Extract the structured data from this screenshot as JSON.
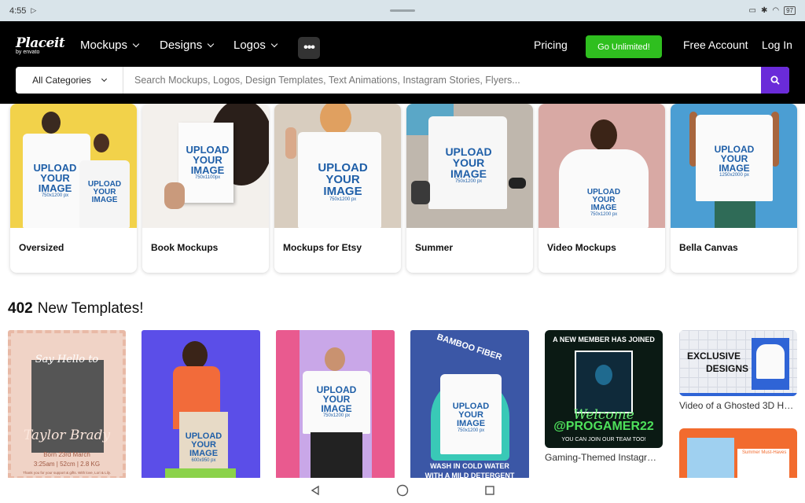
{
  "status": {
    "time": "4:55",
    "battery": "97"
  },
  "nav": {
    "logo_main": "Placeit",
    "logo_sub": "by envato",
    "menus": [
      "Mockups",
      "Designs",
      "Logos"
    ],
    "more": "•••",
    "pricing": "Pricing",
    "go_unlimited": "Go Unlimited!",
    "free_account": "Free Account",
    "login": "Log In"
  },
  "search": {
    "category": "All Categories",
    "placeholder": "Search Mockups, Logos, Design Templates, Text Animations, Instagram Stories, Flyers..."
  },
  "categories": [
    {
      "label": "Oversized"
    },
    {
      "label": "Book Mockups"
    },
    {
      "label": "Mockups for Etsy"
    },
    {
      "label": "Summer"
    },
    {
      "label": "Video Mockups"
    },
    {
      "label": "Bella Canvas"
    }
  ],
  "mock_text": {
    "l1": "UPLOAD",
    "l2": "YOUR",
    "l3": "IMAGE",
    "size_a": "750x1200 px",
    "size_b": "750x1100px",
    "size_c": "600x950 px",
    "size_d": "1250x2000 px"
  },
  "templates_header": {
    "count": "402",
    "label": "New Templates!"
  },
  "templates": {
    "t1": {
      "title1": "Say Hello to",
      "title2": "Taylor Brady",
      "born": "Born 23rd March",
      "stats": "3:25am | 52cm | 2.8 KG",
      "foot": "Thank you for your support & gifts. With love, Lori & Lily."
    },
    "t4": {
      "top": "BAMBOO FIBER",
      "bottom1": "WASH IN COLD WATER",
      "bottom2": "WITH A MILD DETERGENT"
    },
    "t5": {
      "top": "A NEW MEMBER HAS JOINED",
      "welcome": "Welcome",
      "handle": "@PROGAMER22",
      "sub": "YOU CAN JOIN OUR TEAM TOO!",
      "caption": "Gaming-Themed Instagr…"
    },
    "t6": {
      "title1": "EXCLUSIVE",
      "title2": "DESIGNS",
      "caption": "Video of a Ghosted 3D H…",
      "summer": "Summer Must-Haves"
    }
  },
  "colors": {
    "accent": "#6a2bd9",
    "green": "#2fbf1f",
    "navbar": "#000000"
  }
}
